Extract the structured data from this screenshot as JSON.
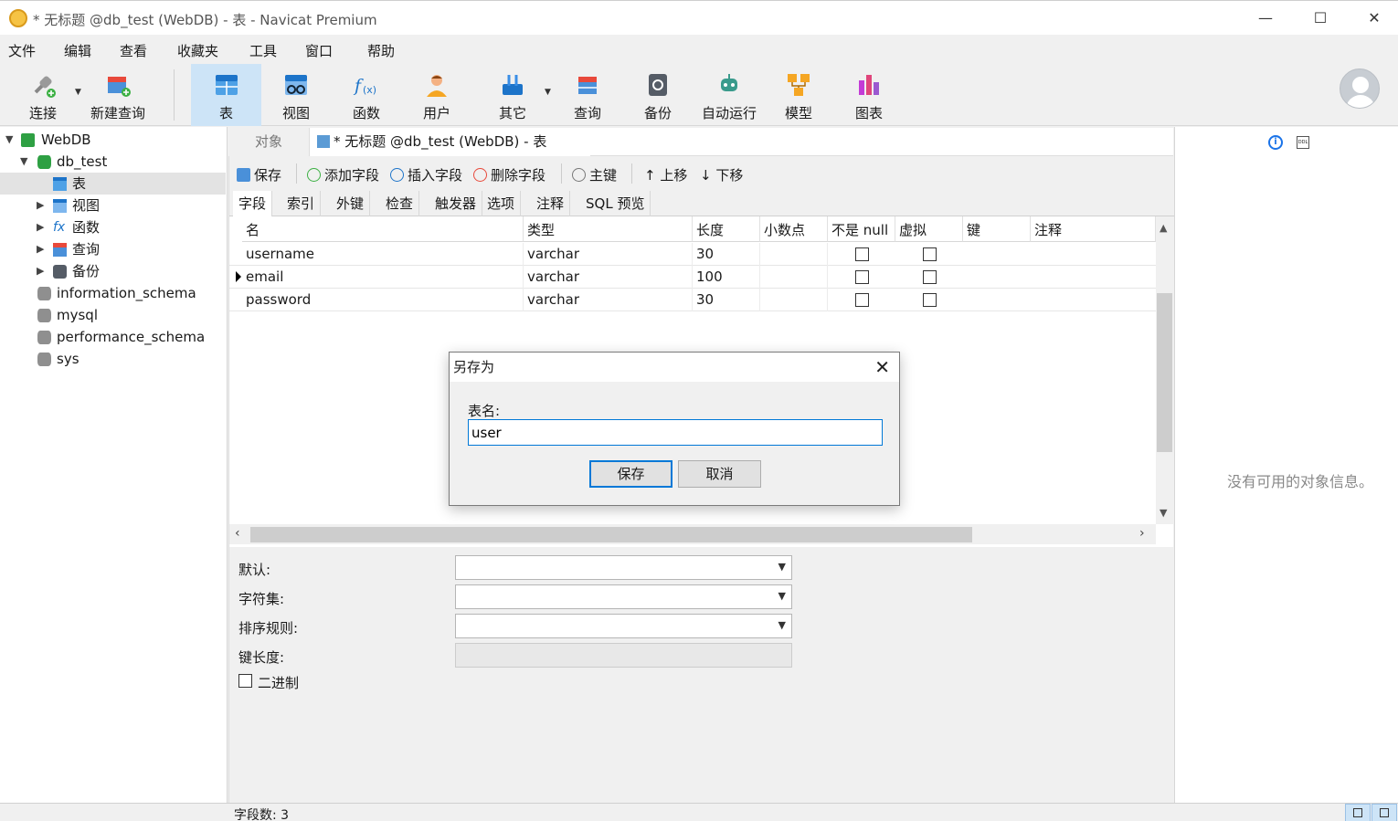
{
  "window": {
    "title": "* 无标题 @db_test (WebDB) - 表 - Navicat Premium",
    "minimize": "—",
    "maximize": "☐",
    "close": "✕"
  },
  "menu": [
    "文件",
    "编辑",
    "查看",
    "收藏夹",
    "工具",
    "窗口",
    "帮助"
  ],
  "toolbar": {
    "connect": "连接",
    "new_query": "新建查询",
    "table": "表",
    "view": "视图",
    "function": "函数",
    "user": "用户",
    "other": "其它",
    "query": "查询",
    "backup": "备份",
    "automation": "自动运行",
    "model": "模型",
    "chart": "图表"
  },
  "sidebar": {
    "connection": "WebDB",
    "database": "db_test",
    "items": [
      "表",
      "视图",
      "函数",
      "查询",
      "备份"
    ],
    "other_dbs": [
      "information_schema",
      "mysql",
      "performance_schema",
      "sys"
    ]
  },
  "tabs": {
    "objects": "对象",
    "document": "* 无标题 @db_test (WebDB) - 表"
  },
  "editor_toolbar": {
    "save": "保存",
    "add_field": "添加字段",
    "insert_field": "插入字段",
    "delete_field": "删除字段",
    "primary_key": "主键",
    "move_up": "上移",
    "move_down": "下移"
  },
  "subtabs": [
    "字段",
    "索引",
    "外键",
    "检查",
    "触发器",
    "选项",
    "注释",
    "SQL 预览"
  ],
  "grid": {
    "headers": [
      "名",
      "类型",
      "长度",
      "小数点",
      "不是 null",
      "虚拟",
      "键",
      "注释"
    ],
    "rows": [
      {
        "name": "username",
        "type": "varchar",
        "length": "30",
        "not_null": false,
        "virtual": false
      },
      {
        "name": "email",
        "type": "varchar",
        "length": "100",
        "not_null": false,
        "virtual": false
      },
      {
        "name": "password",
        "type": "varchar",
        "length": "30",
        "not_null": false,
        "virtual": false
      }
    ]
  },
  "properties": {
    "default": "默认:",
    "charset": "字符集:",
    "collation": "排序规则:",
    "key_length": "键长度:",
    "binary": "二进制"
  },
  "right_panel": {
    "empty": "没有可用的对象信息。"
  },
  "status": {
    "field_count": "字段数: 3"
  },
  "dialog": {
    "title": "另存为",
    "label": "表名:",
    "value": "user",
    "save": "保存",
    "cancel": "取消"
  }
}
